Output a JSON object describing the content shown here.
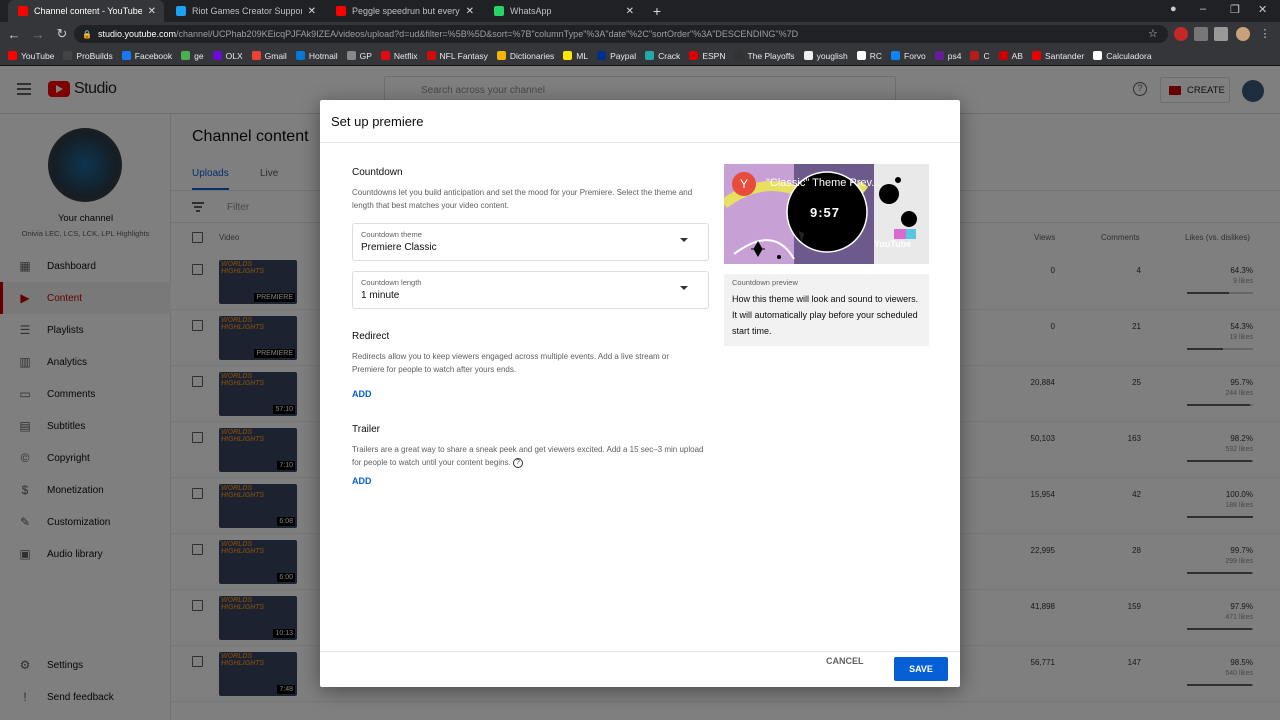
{
  "browser": {
    "tabs": [
      {
        "title": "Channel content - YouTube S",
        "active": true,
        "favicon_color": "#ff0000"
      },
      {
        "title": "Riot Games Creator Support no T",
        "active": false,
        "favicon_color": "#1da1f2"
      },
      {
        "title": "Peggle speedrun but every death",
        "active": false,
        "favicon_color": "#ff0000"
      },
      {
        "title": "WhatsApp",
        "active": false,
        "favicon_color": "#25d366"
      }
    ],
    "url_domain": "studio.youtube.com",
    "url_path": "/channel/UCPhab209KEicqPJFAk9IZEA/videos/upload?d=ud&filter=%5B%5D&sort=%7B\"columnType\"%3A\"date\"%2C\"sortOrder\"%3A\"DESCENDING\"%7D",
    "bookmarks": [
      {
        "label": "YouTube",
        "color": "#ff0000"
      },
      {
        "label": "ProBuilds",
        "color": "#444"
      },
      {
        "label": "Facebook",
        "color": "#1877f2"
      },
      {
        "label": "ge",
        "color": "#4caf50"
      },
      {
        "label": "OLX",
        "color": "#6e0ad6"
      },
      {
        "label": "Gmail",
        "color": "#ea4335"
      },
      {
        "label": "Hotmail",
        "color": "#0078d4"
      },
      {
        "label": "GP",
        "color": "#888"
      },
      {
        "label": "Netflix",
        "color": "#e50914"
      },
      {
        "label": "NFL Fantasy",
        "color": "#d50a0a"
      },
      {
        "label": "Dictionaries",
        "color": "#f5b400"
      },
      {
        "label": "ML",
        "color": "#ffe600"
      },
      {
        "label": "Paypal",
        "color": "#003087"
      },
      {
        "label": "Crack",
        "color": "#2aa"
      },
      {
        "label": "ESPN",
        "color": "#d00"
      },
      {
        "label": "The Playoffs",
        "color": "#333"
      },
      {
        "label": "youglish",
        "color": "#eee"
      },
      {
        "label": "RC",
        "color": "#fff"
      },
      {
        "label": "Forvo",
        "color": "#0a84ff"
      },
      {
        "label": "ps4",
        "color": "#6a1b9a"
      },
      {
        "label": "C",
        "color": "#b71c1c"
      },
      {
        "label": "AB",
        "color": "#c00"
      },
      {
        "label": "Santander",
        "color": "#ec0000"
      },
      {
        "label": "Calculadora",
        "color": "#fff"
      }
    ]
  },
  "studio": {
    "logo_text": "Studio",
    "search_placeholder": "Search across your channel",
    "create_label": "CREATE",
    "channel_name": "Your channel",
    "channel_sub": "Onivia LEC, LCS, LCK, LPL Highlights",
    "page_title": "Channel content",
    "tabs": [
      "Uploads",
      "Live"
    ],
    "filter_label": "Filter",
    "col_video": "Video",
    "col_views": "Views",
    "col_comments": "Comments",
    "col_likes": "Likes (vs. dislikes)",
    "nav": [
      {
        "label": "Dashboard",
        "icon": "dashboard-icon"
      },
      {
        "label": "Content",
        "icon": "content-icon",
        "selected": true
      },
      {
        "label": "Playlists",
        "icon": "playlists-icon"
      },
      {
        "label": "Analytics",
        "icon": "analytics-icon"
      },
      {
        "label": "Comments",
        "icon": "comments-icon"
      },
      {
        "label": "Subtitles",
        "icon": "subtitles-icon"
      },
      {
        "label": "Copyright",
        "icon": "copyright-icon"
      },
      {
        "label": "Monetization",
        "icon": "monetization-icon"
      },
      {
        "label": "Customization",
        "icon": "customization-icon"
      },
      {
        "label": "Audio library",
        "icon": "audio-library-icon"
      }
    ],
    "settings_label": "Settings",
    "feedback_label": "Send feedback",
    "rows": [
      {
        "thumb_label": "WORLDS HIGHLIGHTS",
        "duration": "PREMIERE",
        "views": "0",
        "comments": "4",
        "likes_pct": "64.3%",
        "likes_count": "9 likes",
        "bar": 0.64
      },
      {
        "thumb_label": "WORLDS HIGHLIGHTS",
        "duration": "PREMIERE",
        "views": "0",
        "comments": "21",
        "likes_pct": "54.3%",
        "likes_count": "19 likes",
        "bar": 0.54
      },
      {
        "thumb_label": "WORLDS HIGHLIGHTS",
        "duration": "57:10",
        "views": "20,884",
        "comments": "25",
        "likes_pct": "95.7%",
        "likes_count": "244 likes",
        "bar": 0.96
      },
      {
        "thumb_label": "WORLDS HIGHLIGHTS",
        "duration": "7:10",
        "views": "50,103",
        "comments": "163",
        "likes_pct": "98.2%",
        "likes_count": "532 likes",
        "bar": 0.98
      },
      {
        "thumb_label": "WORLDS HIGHLIGHTS",
        "duration": "6:08",
        "views": "15,954",
        "comments": "42",
        "likes_pct": "100.0%",
        "likes_count": "188 likes",
        "bar": 1.0
      },
      {
        "thumb_label": "WORLDS HIGHLIGHTS",
        "duration": "6:00",
        "views": "22,995",
        "comments": "28",
        "likes_pct": "99.7%",
        "likes_count": "299 likes",
        "bar": 0.99
      },
      {
        "thumb_label": "WORLDS HIGHLIGHTS",
        "duration": "10:13",
        "views": "41,898",
        "comments": "159",
        "likes_pct": "97.9%",
        "likes_count": "471 likes",
        "bar": 0.98
      },
      {
        "thumb_label": "WORLDS HIGHLIGHTS",
        "duration": "7:48",
        "views": "56,771",
        "comments": "147",
        "likes_pct": "98.5%",
        "likes_count": "540 likes",
        "bar": 0.98
      }
    ]
  },
  "dialog": {
    "title": "Set up premiere",
    "countdown_heading": "Countdown",
    "countdown_desc": "Countdowns let you build anticipation and set the mood for your Premiere. Select the theme and length that best matches your video content.",
    "theme_label": "Countdown theme",
    "theme_value": "Premiere Classic",
    "length_label": "Countdown length",
    "length_value": "1 minute",
    "redirect_heading": "Redirect",
    "redirect_desc": "Redirects allow you to keep viewers engaged across multiple events. Add a live stream or Premiere for people to watch after yours ends.",
    "redirect_add": "ADD",
    "trailer_heading": "Trailer",
    "trailer_desc": "Trailers are a great way to share a sneak peek and get viewers excited. Add a 15 sec–3 min upload for people to watch until your content begins.",
    "trailer_add": "ADD",
    "preview_avatar": "Y",
    "preview_title": "\"Classic\" Theme Prev...",
    "preview_timer": "9:57",
    "preview_brand": "YouTube",
    "preview_caption": "Countdown preview",
    "preview_desc": "How this theme will look and sound to viewers. It will automatically play before your scheduled start time.",
    "cancel_label": "CANCEL",
    "save_label": "SAVE",
    "accent_color": "#065fd4"
  }
}
